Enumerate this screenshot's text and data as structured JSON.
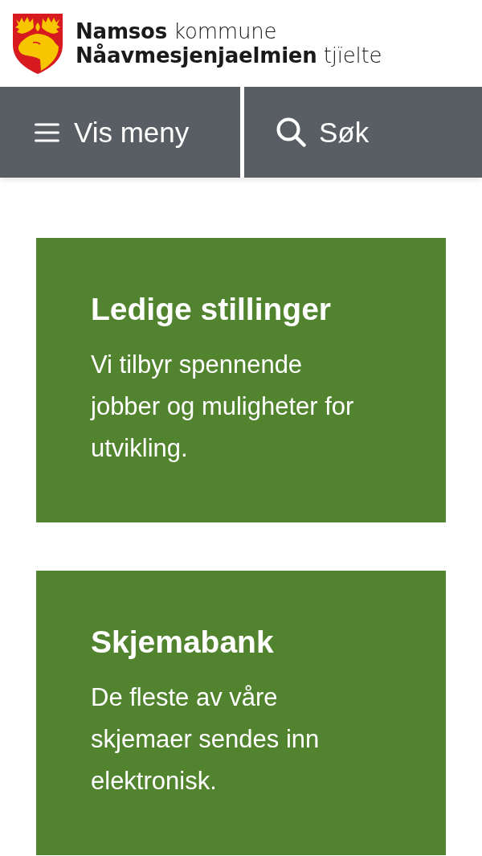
{
  "header": {
    "logo_lines": [
      "**Namsos** kommune",
      "**Nåavmesjenjaelmien** tjïelte"
    ]
  },
  "nav": [
    {
      "label": "Vis meny",
      "kind": "menu"
    },
    {
      "label": "Søk",
      "kind": "search"
    }
  ],
  "cards": [
    {
      "title": "Ledige stillinger",
      "text": "Vi tilbyr spennende jobber og muligheter for utvikling."
    },
    {
      "title": "Skjemabank",
      "text": "De fleste av våre skjemaer sendes inn elektronisk."
    }
  ]
}
